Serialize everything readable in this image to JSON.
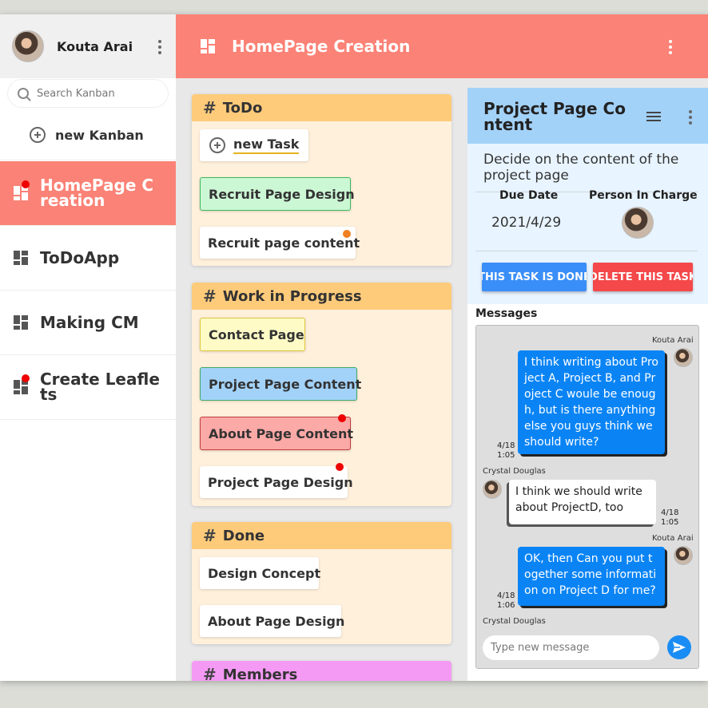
{
  "user": {
    "name": "Kouta Arai"
  },
  "search": {
    "placeholder": "Search Kanban"
  },
  "sidebar": {
    "new_kanban": "new Kanban",
    "items": [
      {
        "label": "HomePage Creation",
        "active": true,
        "has_dot": true
      },
      {
        "label": "ToDoApp",
        "active": false,
        "has_dot": false
      },
      {
        "label": "Making CM",
        "active": false,
        "has_dot": false
      },
      {
        "label": "Create Leaflets",
        "active": false,
        "has_dot": true
      }
    ]
  },
  "header": {
    "title": "HomePage Creation"
  },
  "columns": {
    "todo": {
      "title": "ToDo",
      "new_task": "new Task",
      "cards": [
        "Recruit Page Design",
        "Recruit page content"
      ]
    },
    "wip": {
      "title": "Work in Progress",
      "cards": [
        "Contact Page",
        "Project Page Content",
        "About Page Content",
        "Project Page Design"
      ]
    },
    "done": {
      "title": "Done",
      "cards": [
        "Design Concept",
        "About Page Design"
      ]
    },
    "members": {
      "title": "Members"
    }
  },
  "detail": {
    "title": "Project Page Content",
    "description": "Decide on the content of the project page",
    "due_label": "Due Date",
    "person_label": "Person In Charge",
    "due_value": "2021/4/29",
    "done_button": "THIS TASK IS DONE",
    "delete_button": "DELETE THIS TASK",
    "messages_label": "Messages",
    "input_placeholder": "Type new message"
  },
  "messages": [
    {
      "sender": "Kouta Arai",
      "text": "I think writing about Project A, Project B, and Project C woule be enough, but is there anything else you guys think we should write?",
      "date": "4/18",
      "time": "1:05"
    },
    {
      "sender": "Crystal Douglas",
      "text": "I think we should write about ProjectD, too",
      "date": "4/18",
      "time": "1:05"
    },
    {
      "sender": "Kouta Arai",
      "text": "OK, then Can you put together some information on Project D for me?",
      "date": "4/18",
      "time": "1:06"
    },
    {
      "sender": "Crystal Douglas"
    }
  ],
  "colors": {
    "accent": "#fb8276",
    "header_blue": "#a3d2f9",
    "col_header": "#fecb7a",
    "members_header": "#f59af4",
    "btn_blue": "#3a8ef8",
    "btn_red": "#f4484a"
  },
  "icons": [
    "kebab-icon",
    "search-icon",
    "plus-circle-icon",
    "dashboard-icon",
    "hash-icon",
    "menu-icon",
    "send-icon"
  ]
}
